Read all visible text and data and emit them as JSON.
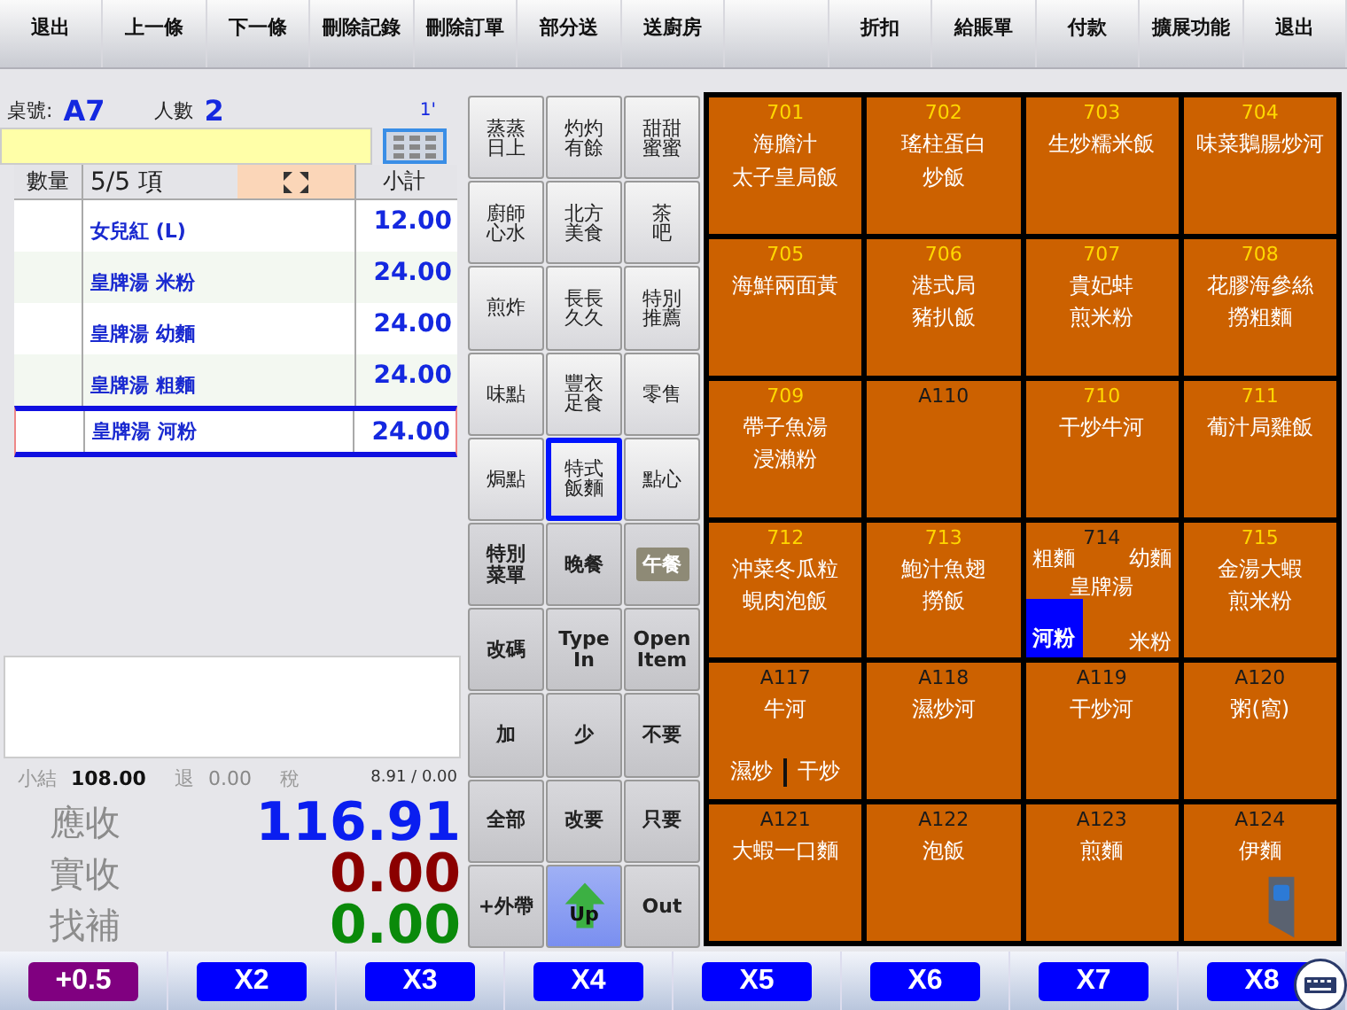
{
  "toolbar": [
    {
      "kind": "button",
      "label": "退出"
    },
    {
      "kind": "button",
      "label": "上一條"
    },
    {
      "kind": "button",
      "label": "下一條"
    },
    {
      "kind": "button",
      "label": "刪除記錄"
    },
    {
      "kind": "button",
      "label": "刪除訂單"
    },
    {
      "kind": "button",
      "label": "部分送"
    },
    {
      "kind": "button",
      "label": "送廚房"
    },
    {
      "kind": "blank"
    },
    {
      "kind": "button",
      "label": "折扣"
    },
    {
      "kind": "button",
      "label": "給賬單"
    },
    {
      "kind": "button",
      "label": "付款"
    },
    {
      "kind": "button",
      "label": "擴展功能"
    },
    {
      "kind": "button",
      "label": "退出"
    }
  ],
  "order_info": {
    "table_label": "桌號:",
    "table": "A7",
    "guests_label": "人數",
    "guests": "2",
    "time": "1'"
  },
  "order_table": {
    "columns": [
      "數量",
      "5/5 項",
      "小計"
    ],
    "rows": [
      {
        "name": "女兒紅 (L)",
        "subtotal": "12.00",
        "selected": false
      },
      {
        "name": "皇牌湯 米粉",
        "subtotal": "24.00",
        "selected": false
      },
      {
        "name": "皇牌湯 幼麵",
        "subtotal": "24.00",
        "selected": false
      },
      {
        "name": "皇牌湯 粗麵",
        "subtotal": "24.00",
        "selected": false
      },
      {
        "name": "皇牌湯 河粉",
        "subtotal": "24.00",
        "selected": true
      }
    ]
  },
  "totals": {
    "subtotal_label": "小結",
    "subtotal": "108.00",
    "refund_label": "退",
    "refund": "0.00",
    "tax_label": "稅",
    "tax": "8.91 / 0.00",
    "due_label": "應收",
    "due": "116.91",
    "paid_label": "實收",
    "paid": "0.00",
    "change_label": "找補",
    "change": "0.00"
  },
  "categories": [
    {
      "kind": "category",
      "lines": [
        "蒸蒸",
        "日上"
      ],
      "selected": false
    },
    {
      "kind": "category",
      "lines": [
        "灼灼",
        "有餘"
      ],
      "selected": false
    },
    {
      "kind": "category",
      "lines": [
        "甜甜",
        "蜜蜜"
      ],
      "selected": false
    },
    {
      "kind": "category",
      "lines": [
        "廚師",
        "心水"
      ],
      "selected": false
    },
    {
      "kind": "category",
      "lines": [
        "北方",
        "美食"
      ],
      "selected": false
    },
    {
      "kind": "category",
      "lines": [
        "茶",
        "吧"
      ],
      "selected": false
    },
    {
      "kind": "category",
      "lines": [
        "煎炸"
      ],
      "selected": false
    },
    {
      "kind": "category",
      "lines": [
        "長長",
        "久久"
      ],
      "selected": false
    },
    {
      "kind": "category",
      "lines": [
        "特別",
        "推薦"
      ],
      "selected": false
    },
    {
      "kind": "category",
      "lines": [
        "味點"
      ],
      "selected": false
    },
    {
      "kind": "category",
      "lines": [
        "豐衣",
        "足食"
      ],
      "selected": false
    },
    {
      "kind": "category",
      "lines": [
        "零售"
      ],
      "selected": false
    },
    {
      "kind": "category",
      "lines": [
        "焗點"
      ],
      "selected": false
    },
    {
      "kind": "category",
      "lines": [
        "特式",
        "飯麵"
      ],
      "selected": true
    },
    {
      "kind": "category",
      "lines": [
        "點心"
      ],
      "selected": false
    },
    {
      "kind": "action",
      "lines": [
        "特別",
        "菜單"
      ]
    },
    {
      "kind": "meal",
      "lines": [
        "晚餐"
      ],
      "active": false
    },
    {
      "kind": "meal",
      "lines": [
        "午餐"
      ],
      "active": true
    },
    {
      "kind": "action",
      "lines": [
        "改碼"
      ]
    },
    {
      "kind": "action",
      "lines": [
        "Type",
        "In"
      ]
    },
    {
      "kind": "action",
      "lines": [
        "Open",
        "Item"
      ]
    },
    {
      "kind": "action",
      "lines": [
        "加"
      ]
    },
    {
      "kind": "action",
      "lines": [
        "少"
      ]
    },
    {
      "kind": "action",
      "lines": [
        "不要"
      ]
    },
    {
      "kind": "action",
      "lines": [
        "全部"
      ]
    },
    {
      "kind": "action",
      "lines": [
        "改要"
      ]
    },
    {
      "kind": "action",
      "lines": [
        "只要"
      ]
    },
    {
      "kind": "action",
      "lines": [
        "+外帶"
      ]
    },
    {
      "kind": "up",
      "lines": [
        "Up"
      ]
    },
    {
      "kind": "action",
      "lines": [
        "Out"
      ]
    }
  ],
  "menu_items": [
    {
      "kind": "plain",
      "code": "701",
      "color": "#ffd700",
      "lines": [
        "海膽汁",
        "太子皇局飯"
      ]
    },
    {
      "kind": "plain",
      "code": "702",
      "color": "#ffd700",
      "lines": [
        "瑤柱蛋白",
        "炒飯"
      ]
    },
    {
      "kind": "plain",
      "code": "703",
      "color": "#ffd700",
      "lines": [
        "生炒糯米飯"
      ]
    },
    {
      "kind": "plain",
      "code": "704",
      "color": "#ffd700",
      "lines": [
        "味菜鵝腸炒河"
      ]
    },
    {
      "kind": "plain",
      "code": "705",
      "color": "#ffd700",
      "lines": [
        "海鮮兩面黃"
      ]
    },
    {
      "kind": "plain",
      "code": "706",
      "color": "#ffd700",
      "lines": [
        "港式局",
        "豬扒飯"
      ]
    },
    {
      "kind": "plain",
      "code": "707",
      "color": "#ffd700",
      "lines": [
        "貴妃蚌",
        "煎米粉"
      ]
    },
    {
      "kind": "plain",
      "code": "708",
      "color": "#ffd700",
      "lines": [
        "花膠海參絲",
        "撈粗麵"
      ]
    },
    {
      "kind": "plain",
      "code": "709",
      "color": "#ffd700",
      "lines": [
        "帶子魚湯",
        "浸瀨粉"
      ]
    },
    {
      "kind": "plain",
      "code": "A110",
      "color": "#1a1a1a"
    },
    {
      "kind": "plain",
      "code": "710",
      "color": "#ffd700",
      "lines": [
        "干炒牛河"
      ]
    },
    {
      "kind": "plain",
      "code": "711",
      "color": "#ffd700",
      "lines": [
        "葡汁局雞飯"
      ]
    },
    {
      "kind": "plain",
      "code": "712",
      "color": "#ffd700",
      "lines": [
        "沖菜冬瓜粒",
        "蜆肉泡飯"
      ]
    },
    {
      "kind": "plain",
      "code": "713",
      "color": "#ffd700",
      "lines": [
        "鮑汁魚翅",
        "撈飯"
      ]
    },
    {
      "kind": "choice",
      "code": "714",
      "color": "#1a1a1a",
      "lines": [
        "皇牌湯"
      ],
      "options": [
        {
          "label": "粗麵",
          "selected": false
        },
        {
          "label": "幼麵",
          "selected": false
        },
        {
          "label": "河粉",
          "selected": true
        },
        {
          "label": "米粉",
          "selected": false
        }
      ]
    },
    {
      "kind": "plain",
      "code": "715",
      "color": "#ffd700",
      "lines": [
        "金湯大蝦",
        "煎米粉"
      ]
    },
    {
      "kind": "split",
      "code": "A117",
      "color": "#1a1a1a",
      "lines": [
        "牛河"
      ],
      "options": [
        {
          "label": "濕炒",
          "selected": false
        },
        {
          "label": "干炒",
          "selected": false
        }
      ]
    },
    {
      "kind": "plain",
      "code": "A118",
      "color": "#1a1a1a",
      "lines": [
        "濕炒河"
      ]
    },
    {
      "kind": "plain",
      "code": "A119",
      "color": "#1a1a1a",
      "lines": [
        "干炒河"
      ]
    },
    {
      "kind": "plain",
      "code": "A120",
      "color": "#1a1a1a",
      "lines": [
        "粥(窩)"
      ]
    },
    {
      "kind": "plain",
      "code": "A121",
      "color": "#1a1a1a",
      "lines": [
        "大蝦一口麵"
      ]
    },
    {
      "kind": "plain",
      "code": "A122",
      "color": "#1a1a1a",
      "lines": [
        "泡飯"
      ]
    },
    {
      "kind": "plain",
      "code": "A123",
      "color": "#1a1a1a",
      "lines": [
        "煎麵"
      ]
    },
    {
      "kind": "plain",
      "code": "A124",
      "color": "#1a1a1a",
      "lines": [
        "伊麵"
      ]
    }
  ],
  "multipliers": [
    {
      "label": "+0.5",
      "color": "#800080"
    },
    {
      "label": "X2",
      "color": "#0000ff"
    },
    {
      "label": "X3",
      "color": "#0000ff"
    },
    {
      "label": "X4",
      "color": "#0000ff"
    },
    {
      "label": "X5",
      "color": "#0000ff"
    },
    {
      "label": "X6",
      "color": "#0000ff"
    },
    {
      "label": "X7",
      "color": "#0000ff"
    },
    {
      "label": "X8",
      "color": "#0000ff"
    }
  ]
}
